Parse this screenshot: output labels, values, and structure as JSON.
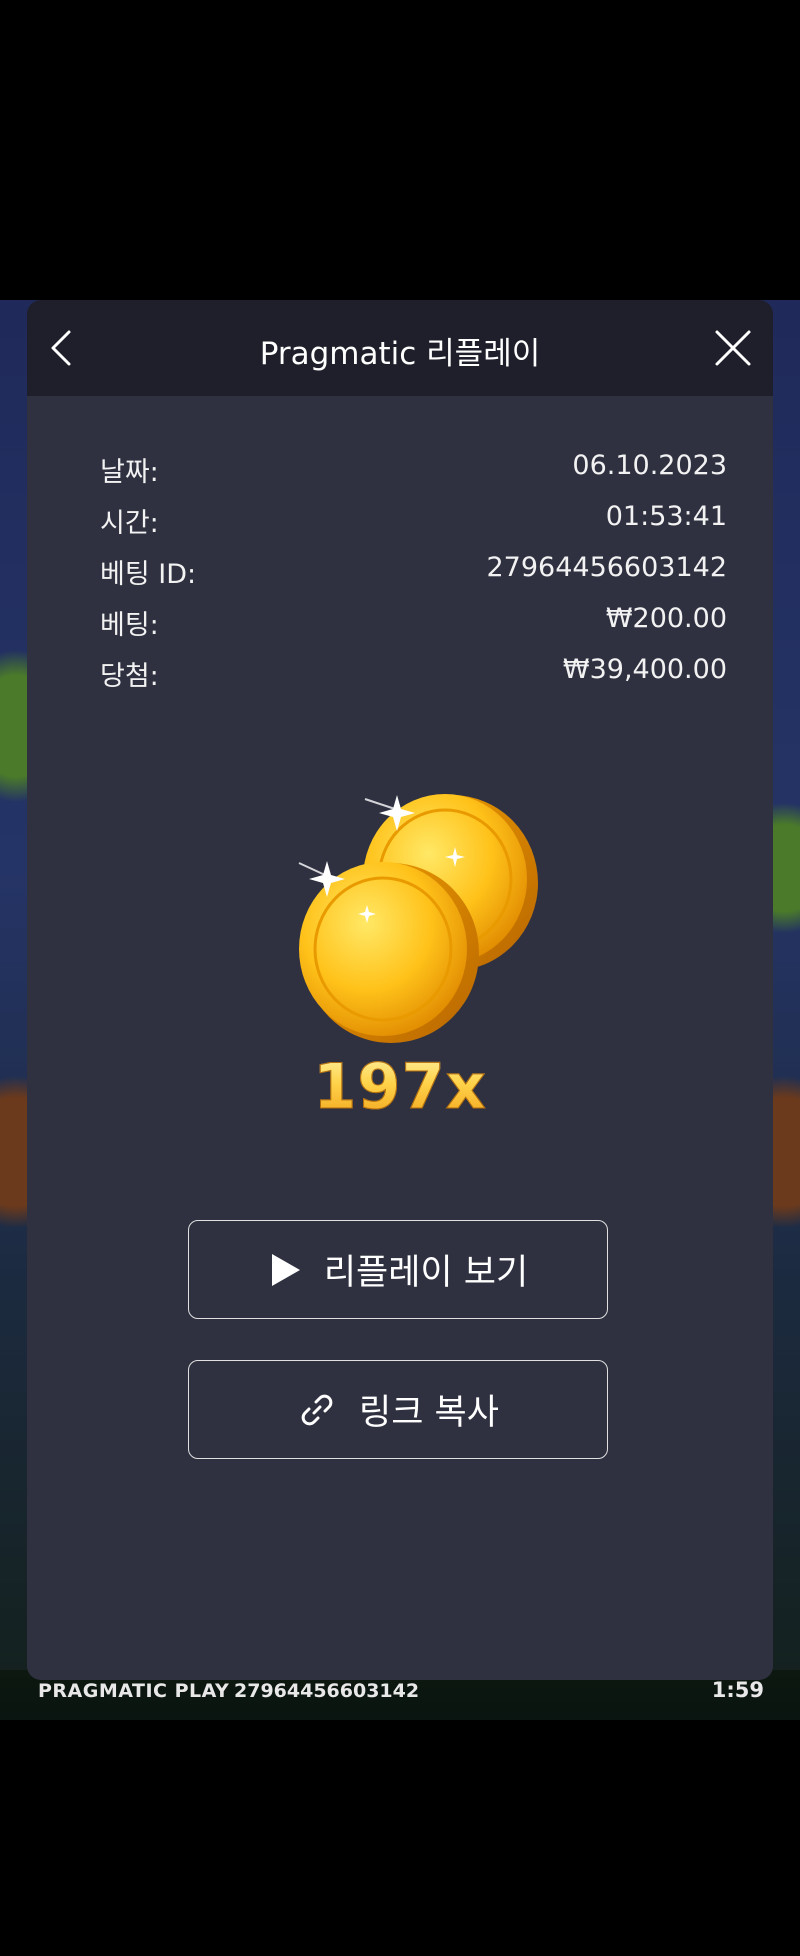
{
  "modal": {
    "title": "Pragmatic 리플레이"
  },
  "info": [
    {
      "label": "날짜:",
      "value": "06.10.2023"
    },
    {
      "label": "시간:",
      "value": "01:53:41"
    },
    {
      "label": "베팅 ID:",
      "value": "27964456603142"
    },
    {
      "label": "베팅:",
      "value": "₩200.00"
    },
    {
      "label": "당첨:",
      "value": "₩39,400.00"
    }
  ],
  "result": {
    "multiplier": "197x"
  },
  "buttons": {
    "replay_label": "리플레이 보기",
    "copy_link_label": "링크 복사"
  },
  "game_footer": {
    "brand": "PRAGMATIC PLAY",
    "bet_id": "27964456603142",
    "clock": "1:59"
  },
  "colors": {
    "modal_bg": "#2f3141",
    "header_bg": "#1e1f2b",
    "coin_gold": "#ffc21a"
  },
  "icons": {
    "back": "chevron-left-icon",
    "close": "close-icon",
    "play": "play-icon",
    "link": "link-icon"
  }
}
